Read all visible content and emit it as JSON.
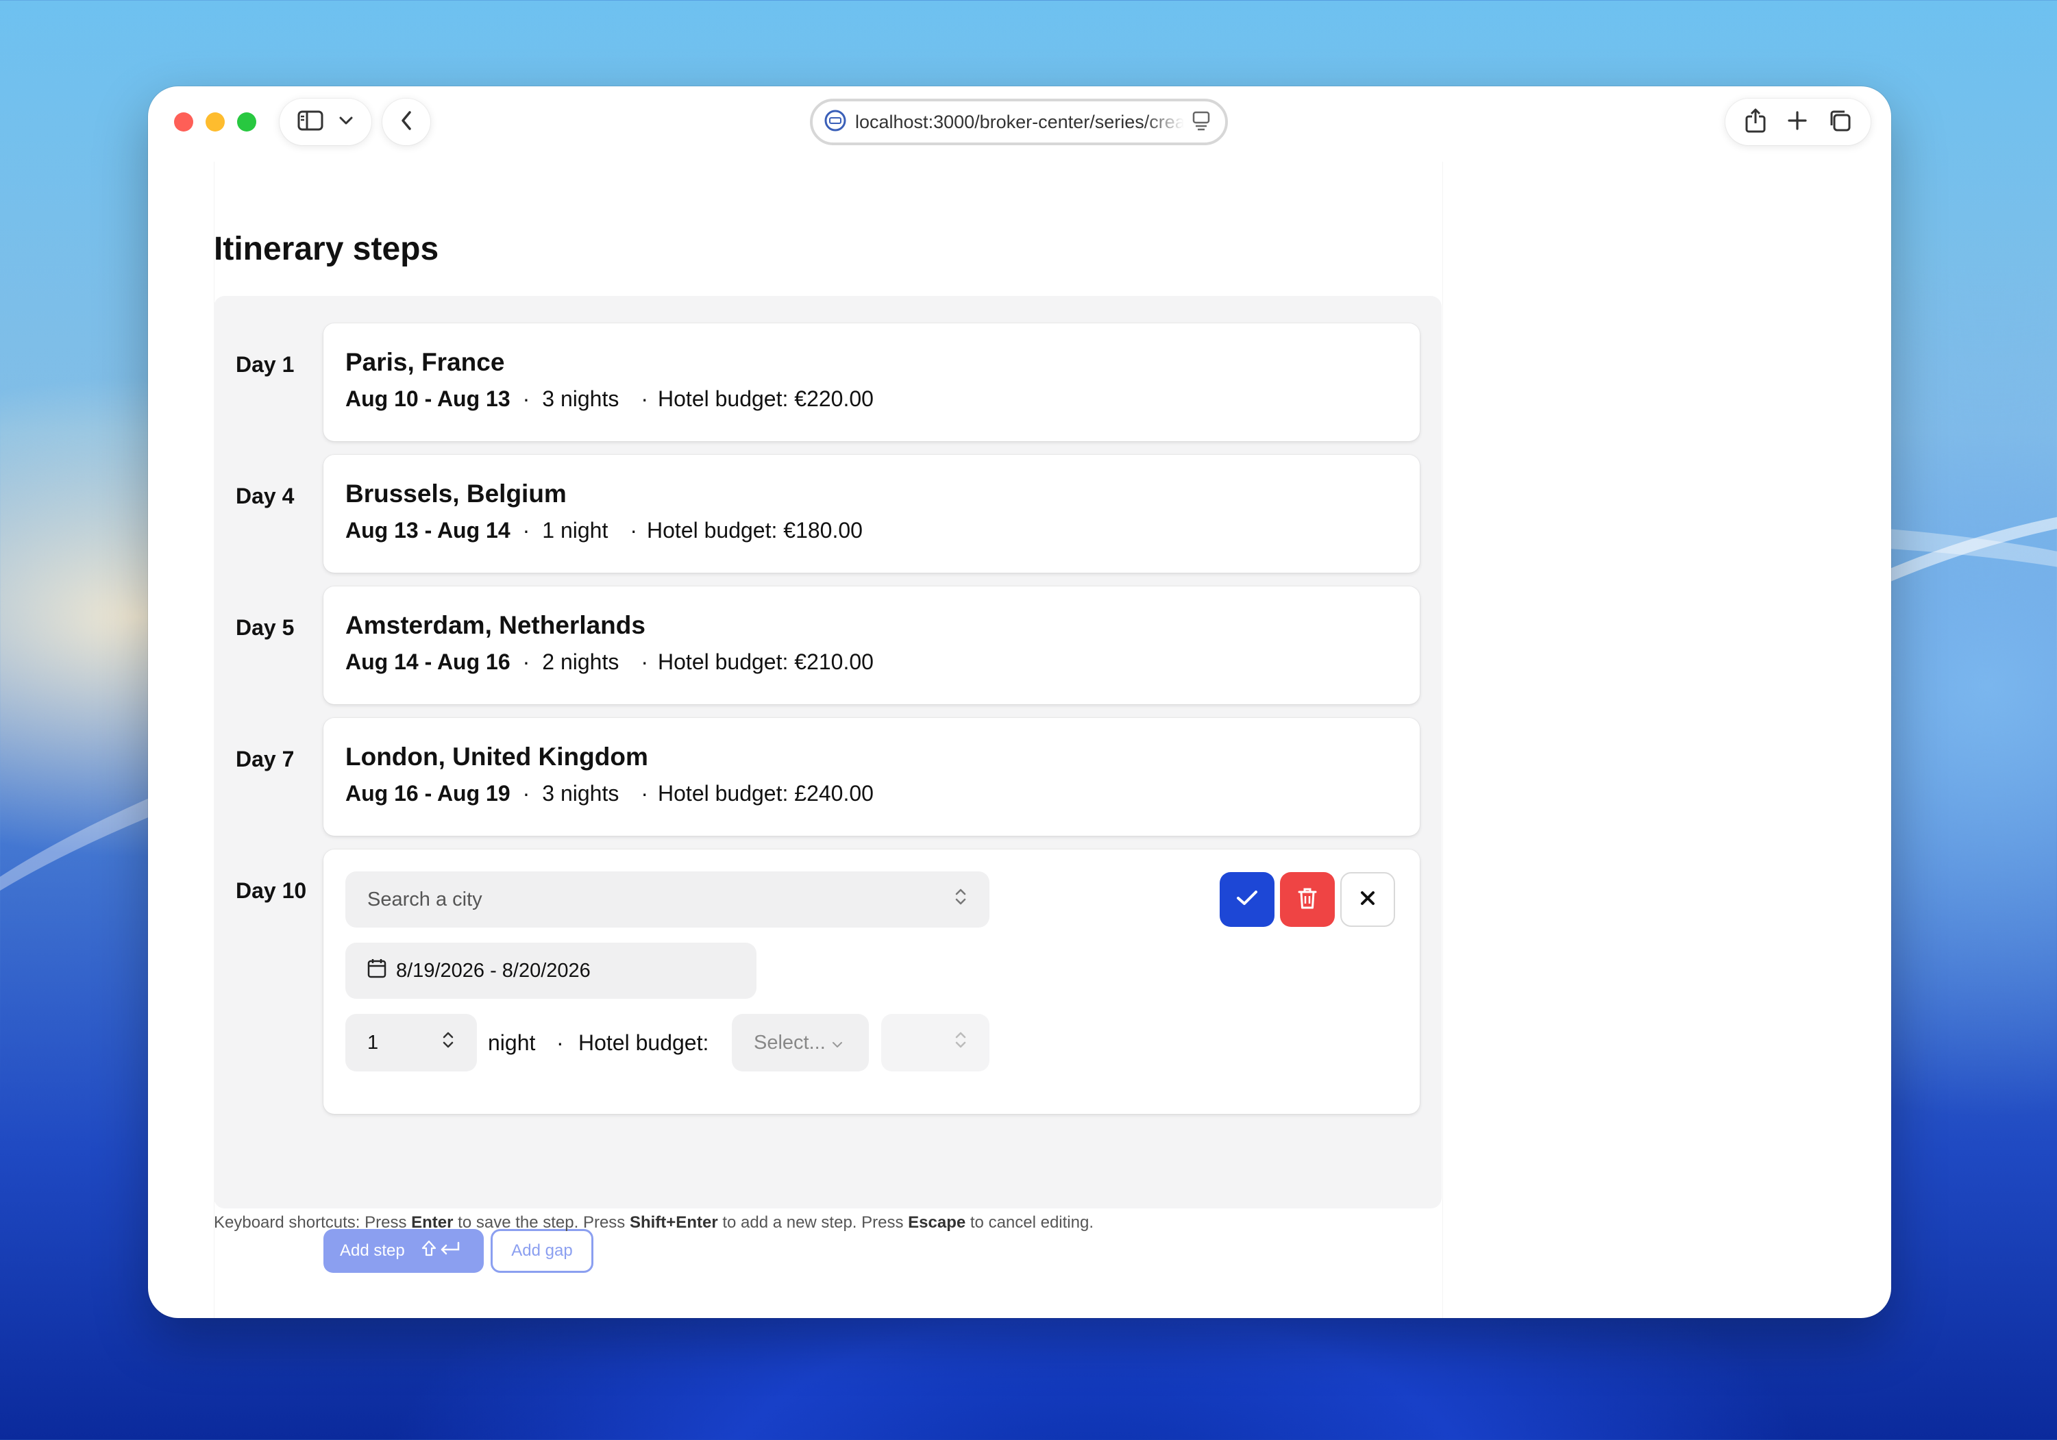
{
  "browser": {
    "url": "localhost:3000/broker-center/series/create"
  },
  "page": {
    "title": "Itinerary steps"
  },
  "steps": [
    {
      "day": "Day 1",
      "city": "Paris, France",
      "dates": "Aug 10 - Aug 13",
      "nights": "3 nights",
      "budget": "Hotel budget: €220.00"
    },
    {
      "day": "Day 4",
      "city": "Brussels, Belgium",
      "dates": "Aug 13 - Aug 14",
      "nights": "1 night",
      "budget": "Hotel budget: €180.00"
    },
    {
      "day": "Day 5",
      "city": "Amsterdam, Netherlands",
      "dates": "Aug 14 - Aug 16",
      "nights": "2 nights",
      "budget": "Hotel budget: €210.00"
    },
    {
      "day": "Day 7",
      "city": "London, United Kingdom",
      "dates": "Aug 16 - Aug 19",
      "nights": "3 nights",
      "budget": "Hotel budget: £240.00"
    }
  ],
  "edit": {
    "day": "Day 10",
    "city_placeholder": "Search a city",
    "date_range": "8/19/2026 - 8/20/2026",
    "nights_value": "1",
    "nights_unit": "night",
    "budget_label": "Hotel budget:",
    "budget_select": "Select..."
  },
  "actions": {
    "add_step": "Add step",
    "add_gap": "Add gap"
  },
  "hint": {
    "p1": "Keyboard shortcuts: Press ",
    "k1": "Enter",
    "p2": " to save the step. Press ",
    "k2": "Shift+Enter",
    "p3": " to add a new step. Press ",
    "k3": "Escape",
    "p4": " to cancel editing."
  },
  "colors": {
    "primary": "#1d47d6",
    "danger": "#ef4444",
    "primary_light": "#8b9ff0"
  }
}
